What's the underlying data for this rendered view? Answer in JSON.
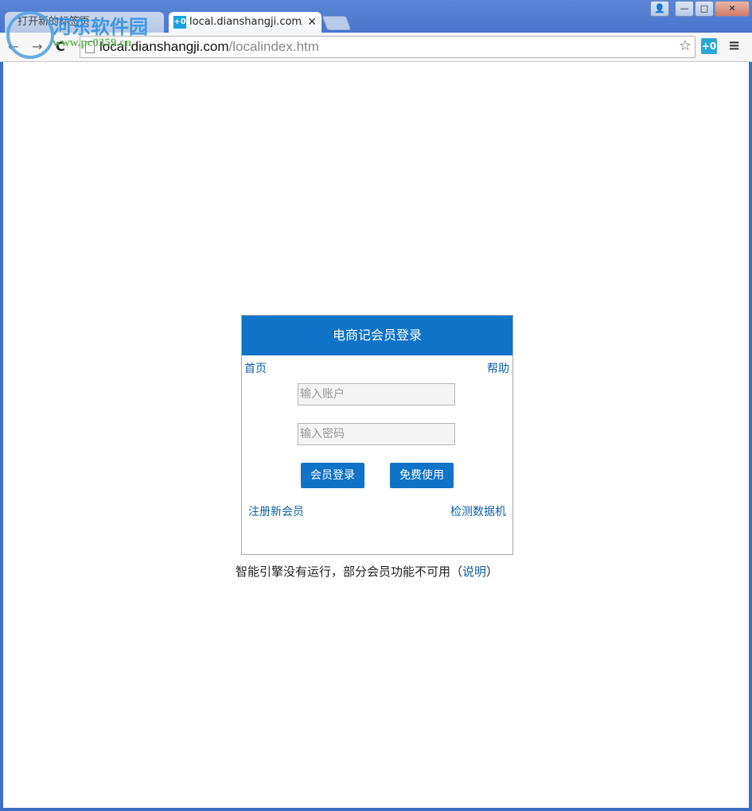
{
  "browser": {
    "tabs": [
      {
        "label": "打开新的标签页"
      },
      {
        "label": "local.dianshangji.com/localindex.htm"
      }
    ],
    "url_host": "local.dianshangji.com",
    "url_path": "/localindex.htm"
  },
  "watermark": {
    "name": "河东软件园",
    "url": "www.pc0359.cn"
  },
  "login": {
    "title": "电商记会员登录",
    "home_link": "首页",
    "help_link": "帮助",
    "account_placeholder": "输入账户",
    "password_placeholder": "输入密码",
    "login_button": "会员登录",
    "free_button": "免费使用",
    "register_link": "注册新会员",
    "detect_link": "检测数据机"
  },
  "notice": {
    "text": "智能引擎没有运行，部分会员功能不可用（",
    "link": "说明",
    "close_paren": "）"
  },
  "colors": {
    "accent": "#0f73c7",
    "link": "#0f5fa6"
  }
}
